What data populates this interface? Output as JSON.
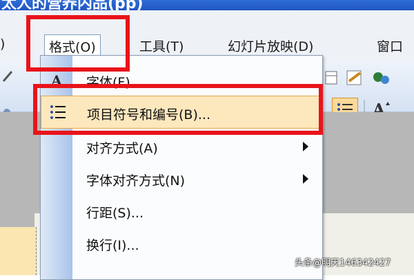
{
  "window": {
    "title_fragment": "太人的营养内品(pp)"
  },
  "menubar": {
    "items": [
      {
        "label": ")"
      },
      {
        "label": "格式(O)"
      },
      {
        "label": "工具(T)"
      },
      {
        "label": "幻灯片放映(D)"
      },
      {
        "label": "窗口"
      }
    ]
  },
  "format_menu": {
    "items": [
      {
        "label": "字体(F)..."
      },
      {
        "label": "项目符号和编号(B)..."
      },
      {
        "label": "对齐方式(A)"
      },
      {
        "label": "字体对齐方式(N)"
      },
      {
        "label": "行距(S)..."
      },
      {
        "label": "换行(I)..."
      }
    ]
  },
  "toolbar": {
    "font_a_glyph": "A"
  },
  "watermark": "头条@明天146342427",
  "colors": {
    "highlight": "#fde7bd",
    "annotation_red": "#e8141a",
    "title_blue": "#1f56c2"
  }
}
